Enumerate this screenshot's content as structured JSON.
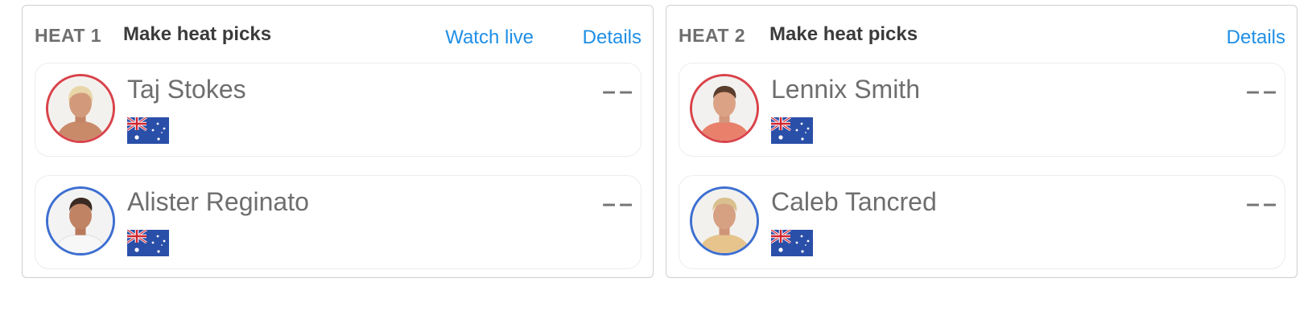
{
  "heats": [
    {
      "heat_label": "HEAT 1",
      "title": "Make heat picks",
      "watch_live_label": "Watch live",
      "details_label": "Details",
      "surfers": [
        {
          "name": "Taj Stokes",
          "score": "– –",
          "country_flag": "australia-flag",
          "jersey_color": "#d9434a"
        },
        {
          "name": "Alister Reginato",
          "score": "– –",
          "country_flag": "australia-flag",
          "jersey_color": "#3d6fd1"
        }
      ]
    },
    {
      "heat_label": "HEAT 2",
      "title": "Make heat picks",
      "details_label": "Details",
      "surfers": [
        {
          "name": "Lennix Smith",
          "score": "– –",
          "country_flag": "australia-flag",
          "jersey_color": "#d9434a"
        },
        {
          "name": "Caleb Tancred",
          "score": "– –",
          "country_flag": "australia-flag",
          "jersey_color": "#3d6fd1"
        }
      ]
    }
  ],
  "colors": {
    "link": "#1f8fe6",
    "red_jersey": "#d9434a",
    "blue_jersey": "#3d6fd1"
  }
}
